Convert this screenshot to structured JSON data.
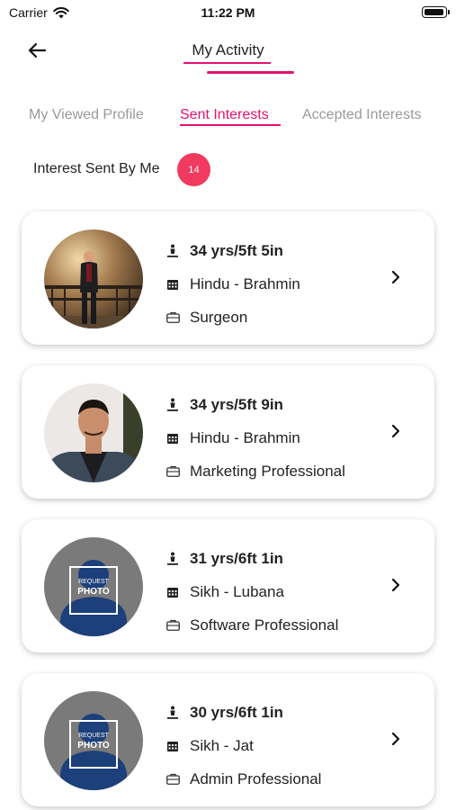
{
  "status_bar": {
    "carrier": "Carrier",
    "time": "11:22 PM"
  },
  "header": {
    "title": "My Activity"
  },
  "tabs": [
    {
      "label": "My Viewed Profile",
      "active": false
    },
    {
      "label": "Sent Interests",
      "active": true
    },
    {
      "label": "Accepted Interests",
      "active": false
    }
  ],
  "interests": {
    "label": "Interest Sent By Me",
    "count": "14"
  },
  "profiles": [
    {
      "age_height": "34 yrs/5ft 5in",
      "religion_caste": "Hindu - Brahmin",
      "profession": "Surgeon",
      "photo": "photo-man-standing"
    },
    {
      "age_height": "34 yrs/5ft 9in",
      "religion_caste": "Hindu - Brahmin",
      "profession": "Marketing Professional",
      "photo": "photo-man-portrait"
    },
    {
      "age_height": "31 yrs/6ft 1in",
      "religion_caste": "Sikh - Lubana",
      "profession": "Software Professional",
      "photo": "request-photo-placeholder",
      "placeholder_line1": "REQUEST",
      "placeholder_line2": "PHOTO"
    },
    {
      "age_height": "30 yrs/6ft 1in",
      "religion_caste": "Sikh - Jat",
      "profession": "Admin Professional",
      "photo": "request-photo-placeholder",
      "placeholder_line1": "REQUEST",
      "placeholder_line2": "PHOTO"
    }
  ],
  "colors": {
    "accent": "#e5126f",
    "badge": "#f03a5f",
    "inactive_tab": "#9a9a9a"
  }
}
